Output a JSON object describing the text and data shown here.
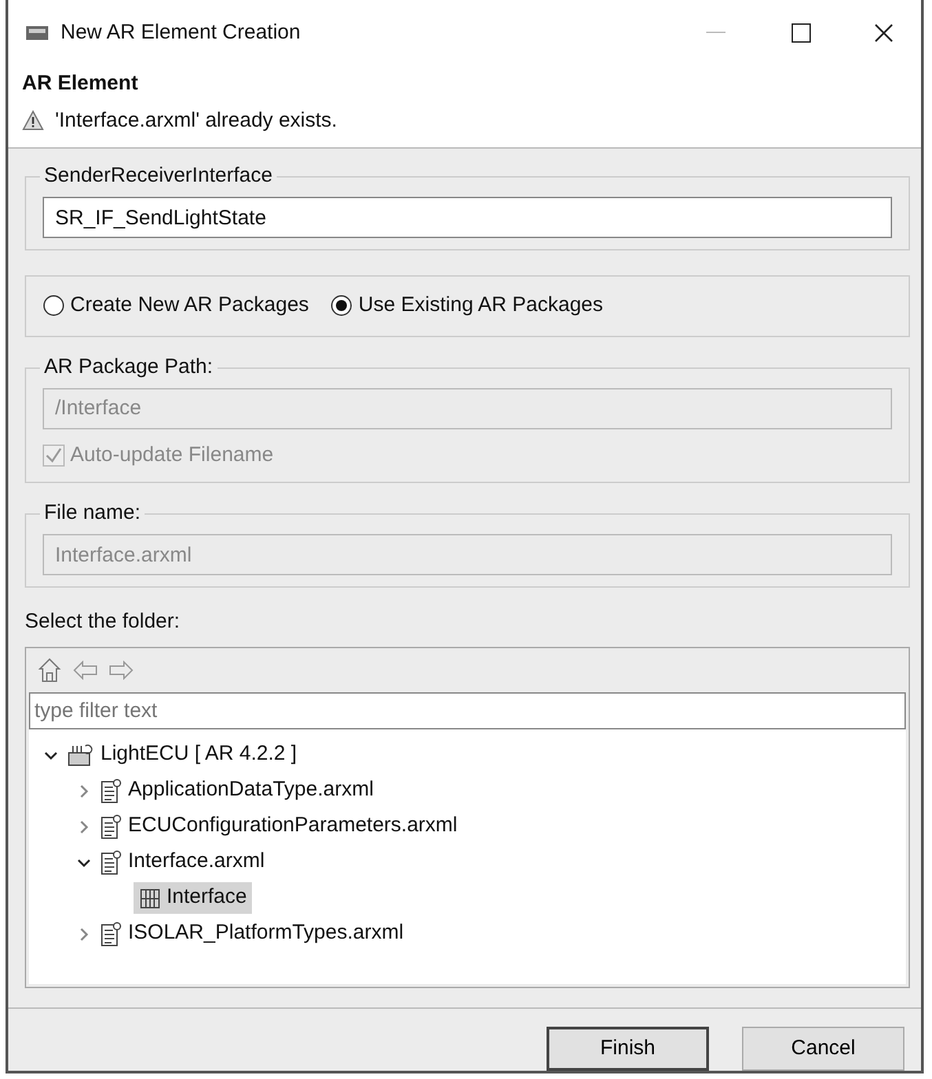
{
  "window": {
    "title": "New AR Element Creation"
  },
  "header": {
    "title": "AR Element",
    "message": "'Interface.arxml' already exists."
  },
  "interface_group": {
    "legend": "SenderReceiverInterface",
    "value": "SR_IF_SendLightState"
  },
  "package_options": [
    {
      "label": "Create New AR Packages",
      "selected": false
    },
    {
      "label": "Use Existing AR Packages",
      "selected": true
    }
  ],
  "package_path": {
    "legend": "AR Package Path:",
    "value": "/Interface",
    "disabled": true,
    "auto_update": {
      "label": "Auto-update Filename",
      "checked": true,
      "disabled": true
    }
  },
  "file_name": {
    "legend": "File name:",
    "value": "Interface.arxml",
    "disabled": true
  },
  "folder": {
    "label": "Select the folder:",
    "filter": {
      "placeholder": "type filter text"
    },
    "tree": [
      {
        "label": "LightECU [ AR 4.2.2 ]",
        "kind": "project",
        "expanded": true,
        "selected": false,
        "children": [
          {
            "label": "ApplicationDataType.arxml",
            "kind": "file",
            "expanded": false,
            "selected": false
          },
          {
            "label": "ECUConfigurationParameters.arxml",
            "kind": "file",
            "expanded": false,
            "selected": false
          },
          {
            "label": "Interface.arxml",
            "kind": "file",
            "expanded": true,
            "selected": false,
            "children": [
              {
                "label": "Interface",
                "kind": "package",
                "selected": true
              }
            ]
          },
          {
            "label": "ISOLAR_PlatformTypes.arxml",
            "kind": "file",
            "expanded": false,
            "selected": false
          }
        ]
      }
    ]
  },
  "buttons": [
    {
      "label": "Finish",
      "default": true
    },
    {
      "label": "Cancel",
      "default": false
    }
  ]
}
